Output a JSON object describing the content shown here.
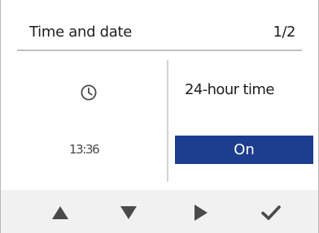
{
  "header": {
    "title": "Time and date",
    "page_indicator": "1/2"
  },
  "left_panel": {
    "icon": "clock-icon",
    "time": "13:36"
  },
  "right_panel": {
    "setting_label": "24-hour time",
    "setting_value": "On"
  },
  "nav": {
    "buttons": [
      {
        "icon": "arrow-up-icon"
      },
      {
        "icon": "arrow-down-icon"
      },
      {
        "icon": "arrow-right-icon"
      },
      {
        "icon": "checkmark-icon"
      }
    ]
  },
  "colors": {
    "selection_background": "#1d3d8e",
    "nav_bar_background": "#f1f1f1",
    "icon_color": "#4a4a4a"
  }
}
